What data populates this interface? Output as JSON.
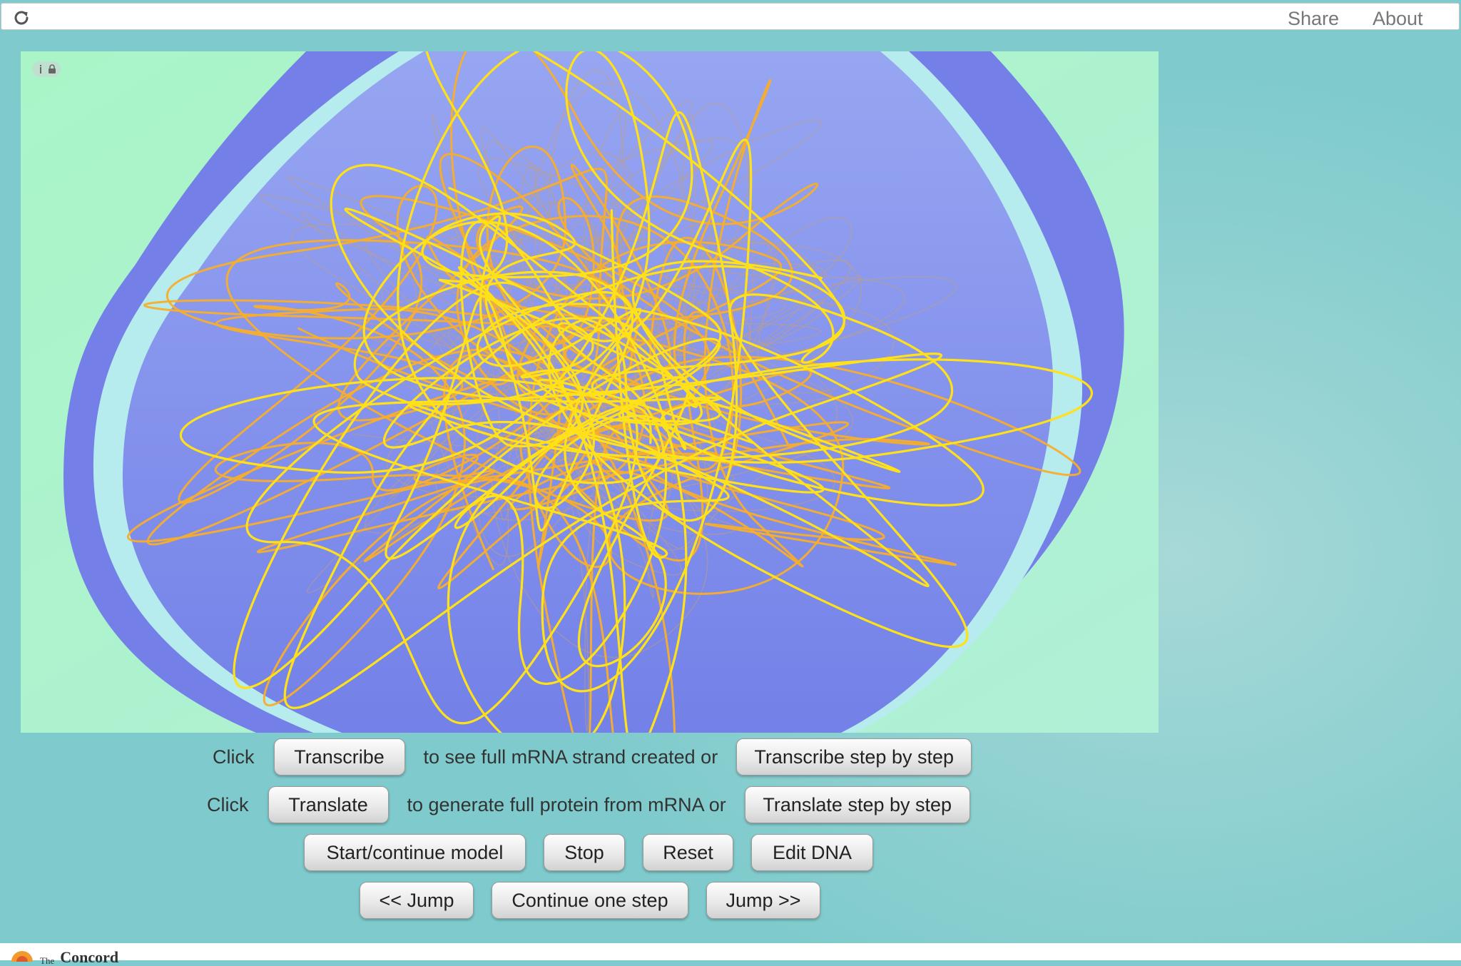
{
  "header": {
    "share_label": "Share",
    "about_label": "About"
  },
  "rows": {
    "transcribe_prefix": "Click",
    "transcribe_button": "Transcribe",
    "transcribe_mid": "to see full mRNA strand created or",
    "transcribe_step_button": "Transcribe step by step",
    "translate_prefix": "Click",
    "translate_button": "Translate",
    "translate_mid": "to generate full protein from mRNA or",
    "translate_step_button": "Translate step by step"
  },
  "controls": {
    "start_label": "Start/continue model",
    "stop_label": "Stop",
    "reset_label": "Reset",
    "edit_dna_label": "Edit DNA",
    "jump_back_label": "<< Jump",
    "continue_step_label": "Continue one step",
    "jump_forward_label": "Jump >>"
  },
  "footer": {
    "logo_the": "The",
    "logo_name": "Concord"
  },
  "colors": {
    "cytoplasm": "#aef2cc",
    "membrane_outer": "#7480e8",
    "membrane_inner": "#b6ecee",
    "nucleus_top": "#96a6f0",
    "nucleus_bottom": "#7480e8",
    "dna_yellow": "#ffe11a",
    "dna_orange": "#f8ae2c"
  },
  "icons": {
    "reload": "reload-icon",
    "info": "info-icon",
    "lock": "lock-icon",
    "logo": "concord-logo-icon"
  }
}
